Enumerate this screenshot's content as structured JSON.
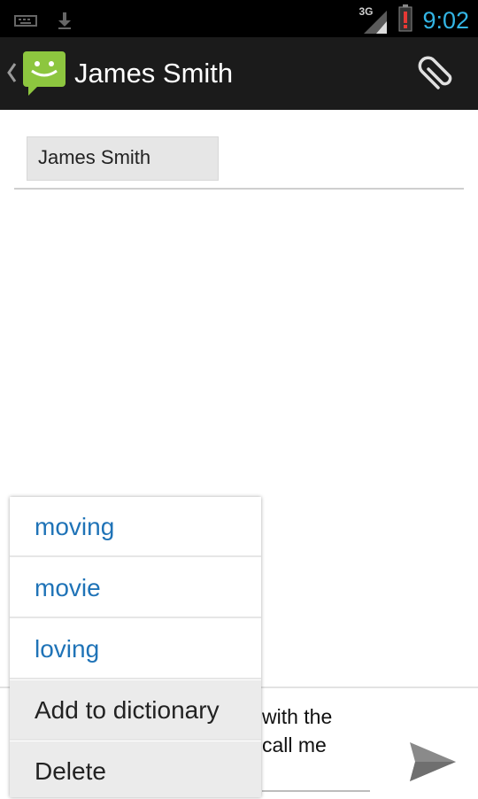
{
  "status_bar": {
    "time": "9:02",
    "network_label": "3G",
    "icons": [
      "keyboard-icon",
      "download-icon",
      "signal-icon",
      "battery-alert-icon"
    ],
    "time_color": "#33b5e5"
  },
  "action_bar": {
    "title": "James Smith",
    "icons": [
      "back-chevron-icon",
      "messaging-app-icon",
      "attach-icon"
    ],
    "app_icon_color": "#8dc63f"
  },
  "recipients": {
    "chip_label": "James Smith"
  },
  "compose": {
    "visible_text": "with the\ncall me",
    "send_icon": "send-icon"
  },
  "suggestions": {
    "items": [
      "moving",
      "movie",
      "loving"
    ],
    "actions": [
      "Add to dictionary",
      "Delete"
    ],
    "text_color": "#1f73b7"
  }
}
